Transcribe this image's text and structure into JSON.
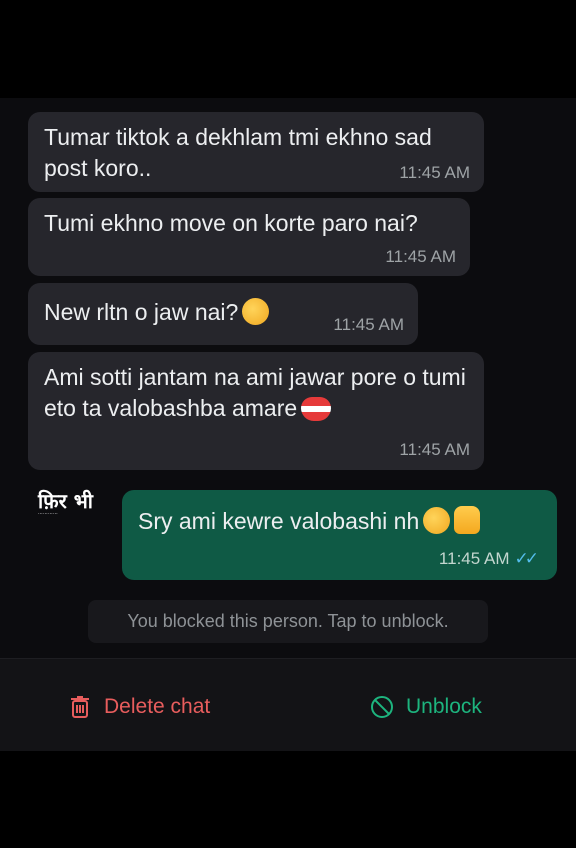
{
  "messages": [
    {
      "text": "Tumar tiktok a dekhlam tmi ekhno sad post koro..",
      "time": "11:45 AM"
    },
    {
      "text": "Tumi ekhno move on korte paro nai?",
      "time": "11:45 AM"
    },
    {
      "text": "New rltn o jaw nai?",
      "emoji": "hugging-face-emoji",
      "time": "11:45 AM"
    },
    {
      "text": "Ami sotti jantam na ami jawar pore o tumi eto ta valobashba amare",
      "emoji": "mending-heart-emoji",
      "time": "11:45 AM"
    },
    {
      "text": "Sry ami kewre valobashi nh",
      "emoji": [
        "relieved-face-emoji",
        "thumbs-up-emoji"
      ],
      "time": "11:45 AM",
      "status": "read"
    }
  ],
  "watermark": {
    "title": "फ़िर भी"
  },
  "system": {
    "blocked_notice": "You blocked this person. Tap to unblock."
  },
  "actions": {
    "delete_label": "Delete chat",
    "unblock_label": "Unblock"
  },
  "colors": {
    "incoming_bubble": "#26262c",
    "outgoing_bubble": "#0f5a45",
    "delete": "#e85d5d",
    "unblock": "#1db47e",
    "read_ticks": "#53bdeb"
  }
}
